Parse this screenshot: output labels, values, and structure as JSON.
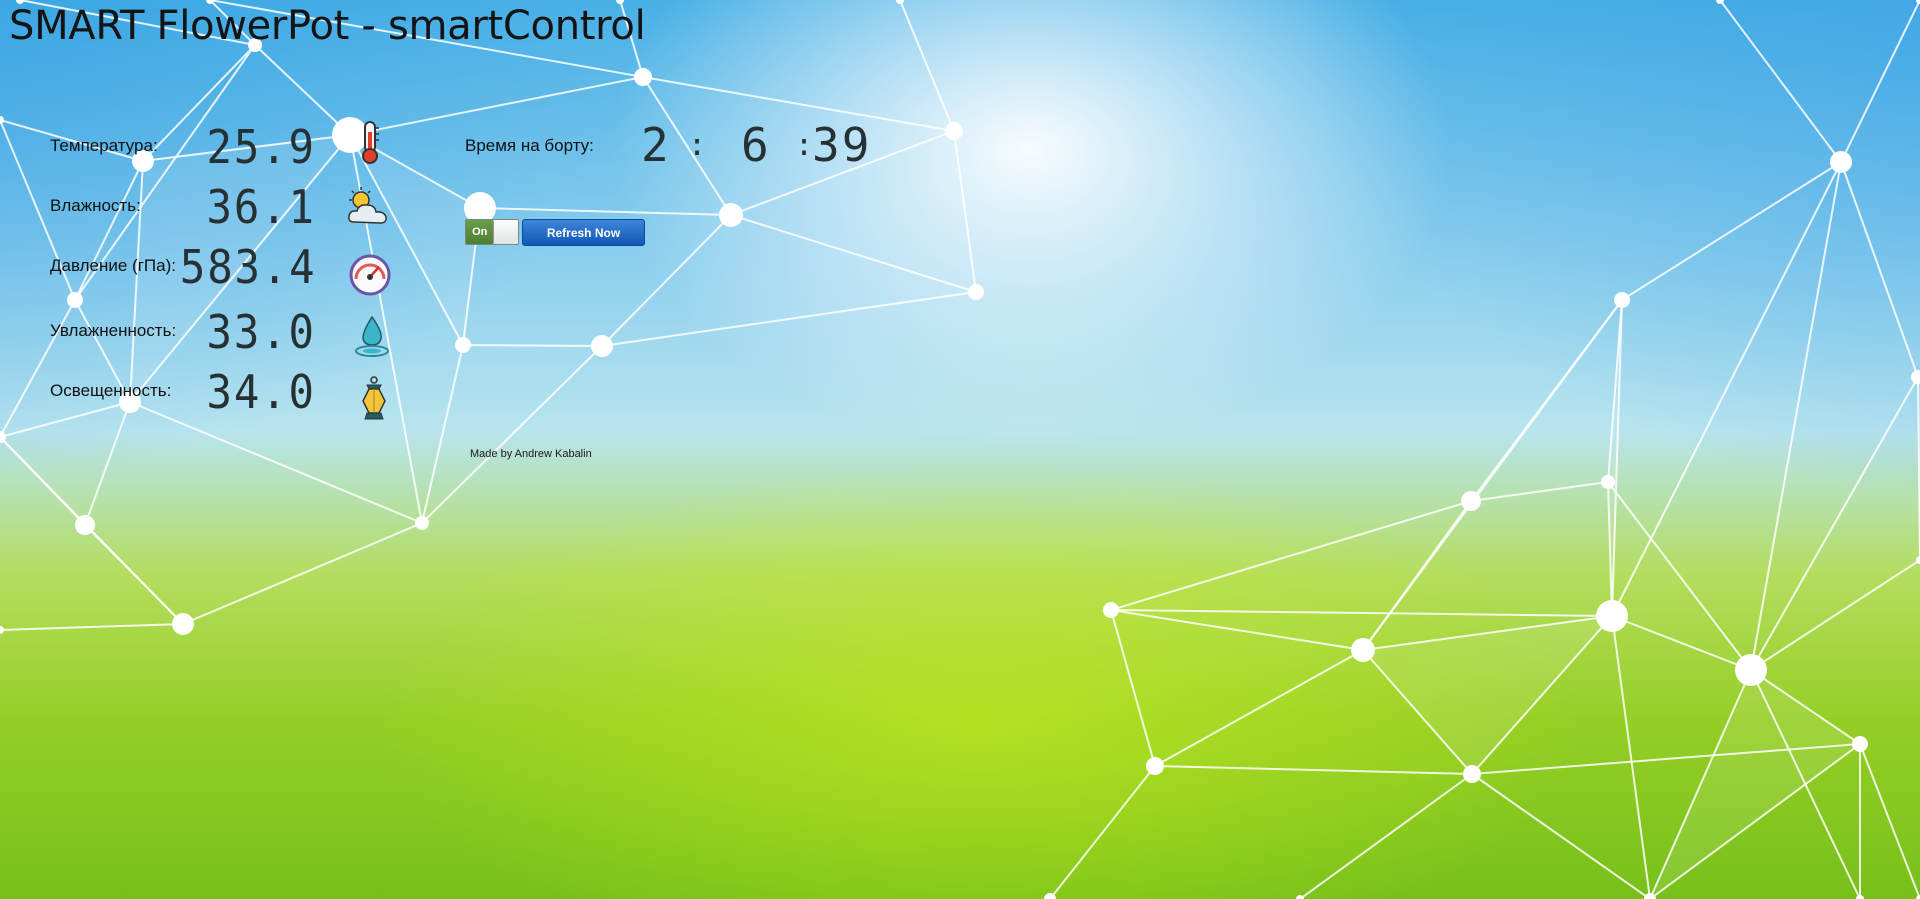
{
  "app": {
    "title": "SMART FlowerPot - smartControl"
  },
  "sensors": [
    {
      "label": "Температура:",
      "value": "25.9",
      "icon": "thermometer-icon"
    },
    {
      "label": "Влажность:",
      "value": "36.1",
      "icon": "weather-cloud-sun-icon"
    },
    {
      "label": "Давление (гПа):",
      "value": "583.4",
      "icon": "speedometer-gauge-icon"
    },
    {
      "label": "Увлажненность:",
      "value": "33.0",
      "icon": "water-drop-icon"
    },
    {
      "label": "Освещенность:",
      "value": "34.0",
      "icon": "lantern-icon"
    }
  ],
  "uptime": {
    "label": "Время на борту:",
    "hours": "2",
    "minutes": "6",
    "seconds": "39",
    "separator": ":"
  },
  "controls": {
    "toggle_label": "On",
    "toggle_state": true,
    "refresh_label": "Refresh Now"
  },
  "footer": {
    "credit": "Made by Andrew Kabalin"
  },
  "colors": {
    "refresh_button": "#1e6cc8",
    "toggle_on": "#5a8f3e",
    "lcd_text": "#273033"
  }
}
